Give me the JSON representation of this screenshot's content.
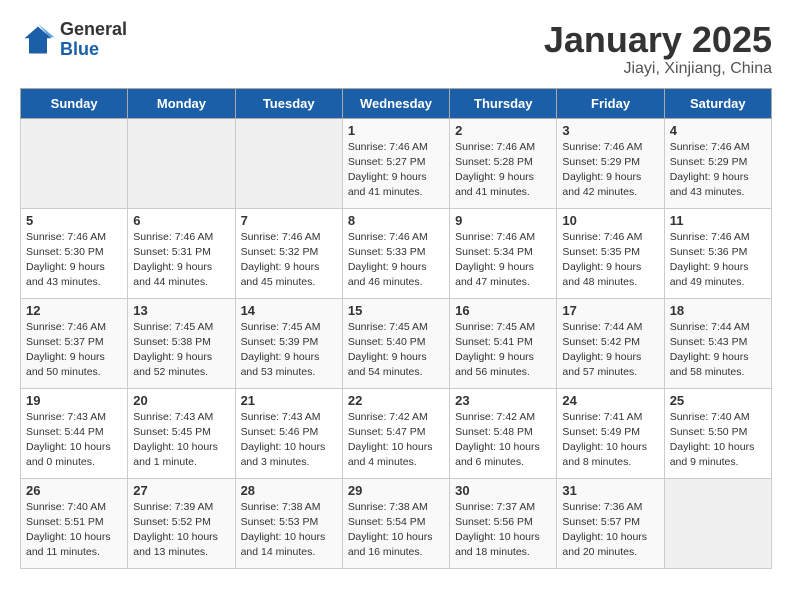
{
  "logo": {
    "general": "General",
    "blue": "Blue"
  },
  "title": "January 2025",
  "location": "Jiayi, Xinjiang, China",
  "weekdays": [
    "Sunday",
    "Monday",
    "Tuesday",
    "Wednesday",
    "Thursday",
    "Friday",
    "Saturday"
  ],
  "weeks": [
    [
      {
        "day": "",
        "info": ""
      },
      {
        "day": "",
        "info": ""
      },
      {
        "day": "",
        "info": ""
      },
      {
        "day": "1",
        "info": "Sunrise: 7:46 AM\nSunset: 5:27 PM\nDaylight: 9 hours\nand 41 minutes."
      },
      {
        "day": "2",
        "info": "Sunrise: 7:46 AM\nSunset: 5:28 PM\nDaylight: 9 hours\nand 41 minutes."
      },
      {
        "day": "3",
        "info": "Sunrise: 7:46 AM\nSunset: 5:29 PM\nDaylight: 9 hours\nand 42 minutes."
      },
      {
        "day": "4",
        "info": "Sunrise: 7:46 AM\nSunset: 5:29 PM\nDaylight: 9 hours\nand 43 minutes."
      }
    ],
    [
      {
        "day": "5",
        "info": "Sunrise: 7:46 AM\nSunset: 5:30 PM\nDaylight: 9 hours\nand 43 minutes."
      },
      {
        "day": "6",
        "info": "Sunrise: 7:46 AM\nSunset: 5:31 PM\nDaylight: 9 hours\nand 44 minutes."
      },
      {
        "day": "7",
        "info": "Sunrise: 7:46 AM\nSunset: 5:32 PM\nDaylight: 9 hours\nand 45 minutes."
      },
      {
        "day": "8",
        "info": "Sunrise: 7:46 AM\nSunset: 5:33 PM\nDaylight: 9 hours\nand 46 minutes."
      },
      {
        "day": "9",
        "info": "Sunrise: 7:46 AM\nSunset: 5:34 PM\nDaylight: 9 hours\nand 47 minutes."
      },
      {
        "day": "10",
        "info": "Sunrise: 7:46 AM\nSunset: 5:35 PM\nDaylight: 9 hours\nand 48 minutes."
      },
      {
        "day": "11",
        "info": "Sunrise: 7:46 AM\nSunset: 5:36 PM\nDaylight: 9 hours\nand 49 minutes."
      }
    ],
    [
      {
        "day": "12",
        "info": "Sunrise: 7:46 AM\nSunset: 5:37 PM\nDaylight: 9 hours\nand 50 minutes."
      },
      {
        "day": "13",
        "info": "Sunrise: 7:45 AM\nSunset: 5:38 PM\nDaylight: 9 hours\nand 52 minutes."
      },
      {
        "day": "14",
        "info": "Sunrise: 7:45 AM\nSunset: 5:39 PM\nDaylight: 9 hours\nand 53 minutes."
      },
      {
        "day": "15",
        "info": "Sunrise: 7:45 AM\nSunset: 5:40 PM\nDaylight: 9 hours\nand 54 minutes."
      },
      {
        "day": "16",
        "info": "Sunrise: 7:45 AM\nSunset: 5:41 PM\nDaylight: 9 hours\nand 56 minutes."
      },
      {
        "day": "17",
        "info": "Sunrise: 7:44 AM\nSunset: 5:42 PM\nDaylight: 9 hours\nand 57 minutes."
      },
      {
        "day": "18",
        "info": "Sunrise: 7:44 AM\nSunset: 5:43 PM\nDaylight: 9 hours\nand 58 minutes."
      }
    ],
    [
      {
        "day": "19",
        "info": "Sunrise: 7:43 AM\nSunset: 5:44 PM\nDaylight: 10 hours\nand 0 minutes."
      },
      {
        "day": "20",
        "info": "Sunrise: 7:43 AM\nSunset: 5:45 PM\nDaylight: 10 hours\nand 1 minute."
      },
      {
        "day": "21",
        "info": "Sunrise: 7:43 AM\nSunset: 5:46 PM\nDaylight: 10 hours\nand 3 minutes."
      },
      {
        "day": "22",
        "info": "Sunrise: 7:42 AM\nSunset: 5:47 PM\nDaylight: 10 hours\nand 4 minutes."
      },
      {
        "day": "23",
        "info": "Sunrise: 7:42 AM\nSunset: 5:48 PM\nDaylight: 10 hours\nand 6 minutes."
      },
      {
        "day": "24",
        "info": "Sunrise: 7:41 AM\nSunset: 5:49 PM\nDaylight: 10 hours\nand 8 minutes."
      },
      {
        "day": "25",
        "info": "Sunrise: 7:40 AM\nSunset: 5:50 PM\nDaylight: 10 hours\nand 9 minutes."
      }
    ],
    [
      {
        "day": "26",
        "info": "Sunrise: 7:40 AM\nSunset: 5:51 PM\nDaylight: 10 hours\nand 11 minutes."
      },
      {
        "day": "27",
        "info": "Sunrise: 7:39 AM\nSunset: 5:52 PM\nDaylight: 10 hours\nand 13 minutes."
      },
      {
        "day": "28",
        "info": "Sunrise: 7:38 AM\nSunset: 5:53 PM\nDaylight: 10 hours\nand 14 minutes."
      },
      {
        "day": "29",
        "info": "Sunrise: 7:38 AM\nSunset: 5:54 PM\nDaylight: 10 hours\nand 16 minutes."
      },
      {
        "day": "30",
        "info": "Sunrise: 7:37 AM\nSunset: 5:56 PM\nDaylight: 10 hours\nand 18 minutes."
      },
      {
        "day": "31",
        "info": "Sunrise: 7:36 AM\nSunset: 5:57 PM\nDaylight: 10 hours\nand 20 minutes."
      },
      {
        "day": "",
        "info": ""
      }
    ]
  ]
}
